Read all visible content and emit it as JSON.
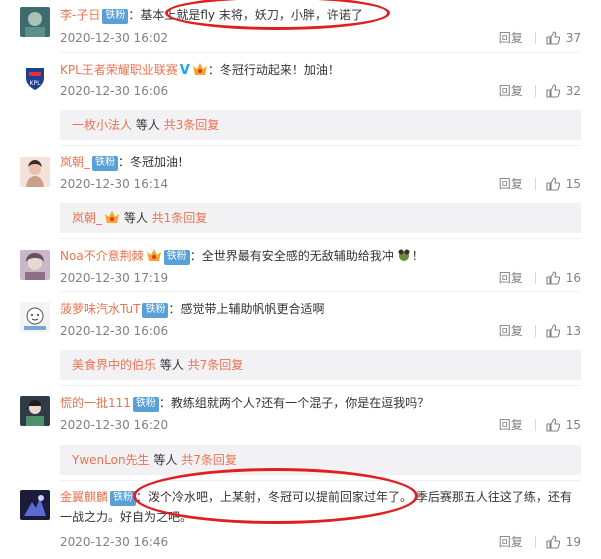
{
  "comments": [
    {
      "username": "李-子日",
      "badge": "铁粉",
      "text_prefix": "：基本上",
      "text_main": "就是fly 末将，妖刀，小胖，许诺了",
      "time": "2020-12-30 16:02",
      "reply_label": "回复",
      "likes": "37"
    },
    {
      "username": "KPL王者荣耀职业联赛",
      "text": "：冬冠行动起来！加油！",
      "time": "2020-12-30 16:06",
      "reply_label": "回复",
      "likes": "32",
      "sub_user": "一枚小法人",
      "sub_mid": " 等人 ",
      "sub_count": "共3条回复"
    },
    {
      "username": "岚朝_",
      "badge": "铁粉",
      "text": "：冬冠加油!",
      "time": "2020-12-30 16:14",
      "reply_label": "回复",
      "likes": "15",
      "sub_user": "岚朝_",
      "sub_mid": " 等人 ",
      "sub_count": "共1条回复"
    },
    {
      "username": "Noa不介意荆棘",
      "badge": "铁粉",
      "text": "：全世界最有安全感的无敌辅助给我冲",
      "text_suffix": "！",
      "time": "2020-12-30 17:19",
      "reply_label": "回复",
      "likes": "16"
    },
    {
      "username": "菠萝味汽水TuT",
      "badge": "铁粉",
      "text": "：感觉带上辅助帆帆更合适啊",
      "time": "2020-12-30 16:06",
      "reply_label": "回复",
      "likes": "13",
      "sub_user": "美食界中的伯乐",
      "sub_mid": " 等人 ",
      "sub_count": "共7条回复"
    },
    {
      "username": "慌的一批111",
      "badge": "铁粉",
      "text": "：教练组就两个人?还有一个混子，你是在逗我吗？",
      "time": "2020-12-30 16:20",
      "reply_label": "回复",
      "likes": "15",
      "sub_user": "YwenLon先生",
      "sub_mid": " 等人 ",
      "sub_count": "共7条回复"
    },
    {
      "username": "金翼麒麟",
      "badge": "铁粉",
      "text_line1": "：泼个冷水吧，上某射，冬冠可以提前回家过年了。 季后赛那五人往这了练，还有",
      "text_line2": "一战之力。好自为之吧。",
      "time": "2020-12-30 16:46",
      "reply_label": "回复",
      "likes": "19"
    }
  ],
  "colors": {
    "username": "#eb7350",
    "badge": "#5aa0d8",
    "annotation": "#e02020",
    "meta": "#808080"
  }
}
